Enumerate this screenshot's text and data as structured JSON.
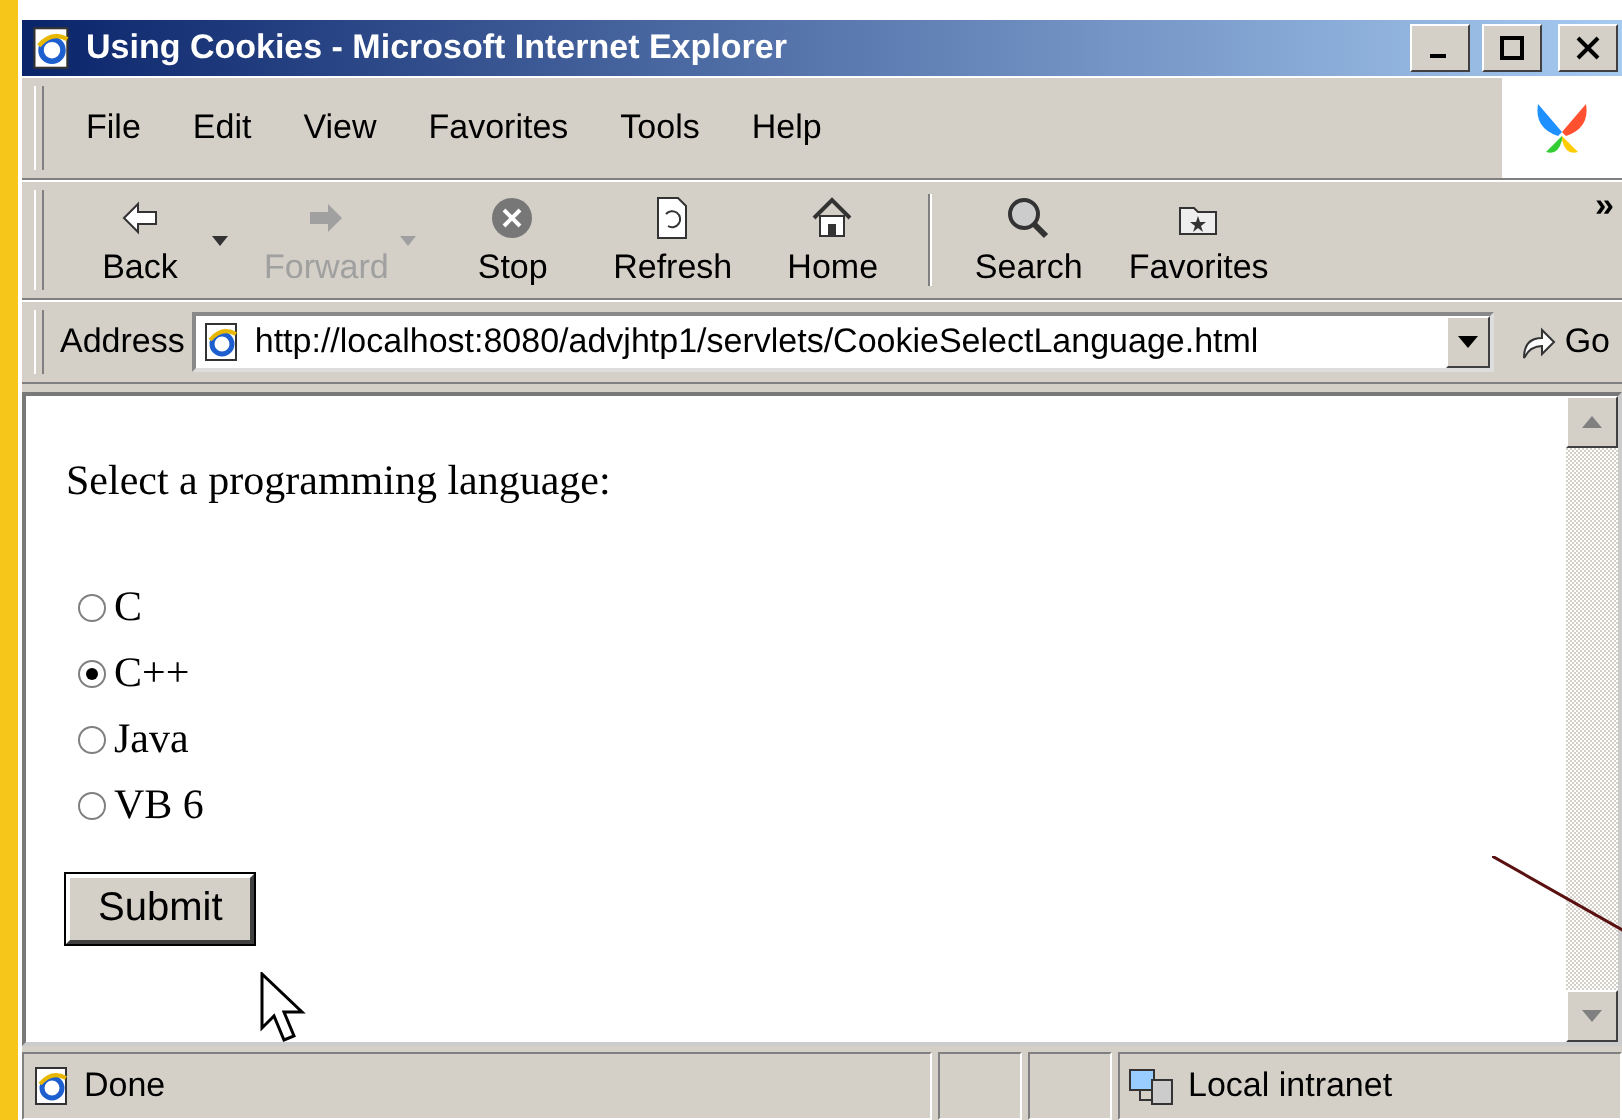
{
  "window": {
    "title": "Using Cookies - Microsoft Internet Explorer"
  },
  "menu": [
    "File",
    "Edit",
    "View",
    "Favorites",
    "Tools",
    "Help"
  ],
  "toolbar": {
    "buttons": [
      {
        "kind": "button",
        "label": "Back",
        "disabled": false,
        "dropdown": true
      },
      {
        "kind": "button",
        "label": "Forward",
        "disabled": true,
        "dropdown": true
      },
      {
        "kind": "button",
        "label": "Stop",
        "disabled": false,
        "dropdown": false
      },
      {
        "kind": "button",
        "label": "Refresh",
        "disabled": false,
        "dropdown": false
      },
      {
        "kind": "button",
        "label": "Home",
        "disabled": false,
        "dropdown": false
      },
      {
        "kind": "separator"
      },
      {
        "kind": "button",
        "label": "Search",
        "disabled": false,
        "dropdown": false
      },
      {
        "kind": "button",
        "label": "Favorites",
        "disabled": false,
        "dropdown": false
      }
    ],
    "overflow": "»"
  },
  "address": {
    "label": "Address",
    "value": "http://localhost:8080/advjhtp1/servlets/CookieSelectLanguage.html",
    "go": "Go"
  },
  "content": {
    "prompt": "Select a programming language:",
    "options": [
      {
        "label": "C",
        "selected": false
      },
      {
        "label": "C++",
        "selected": true
      },
      {
        "label": "Java",
        "selected": false
      },
      {
        "label": "VB 6",
        "selected": false
      }
    ],
    "submit": "Submit"
  },
  "status_bar": {
    "text": "Done",
    "zone": "Local intranet"
  }
}
